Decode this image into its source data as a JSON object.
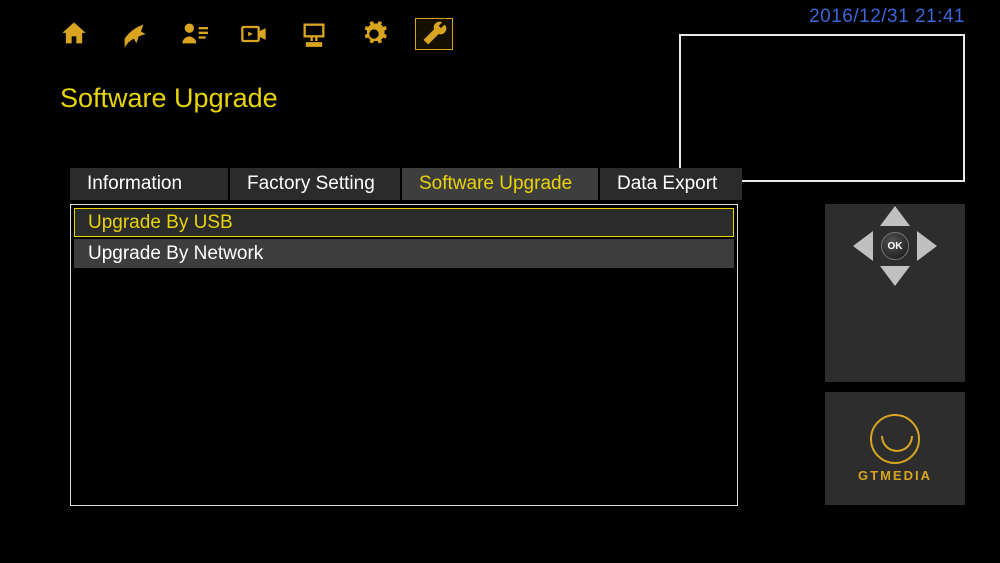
{
  "datetime": "2016/12/31  21:41",
  "page_title": "Software Upgrade",
  "tabs": [
    {
      "label": "Information"
    },
    {
      "label": "Factory Setting"
    },
    {
      "label": "Software Upgrade"
    },
    {
      "label": "Data Export"
    }
  ],
  "list_items": [
    {
      "label": "Upgrade By USB",
      "selected": true
    },
    {
      "label": "Upgrade By Network",
      "selected": false
    }
  ],
  "dpad": {
    "ok_label": "OK"
  },
  "brand": {
    "name": "GTMEDIA"
  },
  "top_icons": [
    "home",
    "satellite",
    "user",
    "video",
    "network",
    "settings",
    "tools"
  ]
}
